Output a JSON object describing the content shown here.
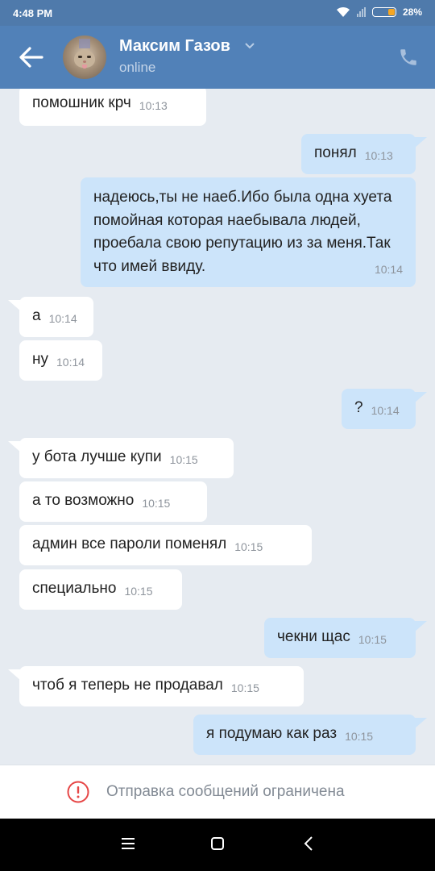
{
  "status_bar": {
    "time": "4:48 PM",
    "battery": "28%",
    "icons": [
      "wifi-icon",
      "signal-icon",
      "battery-icon"
    ]
  },
  "header": {
    "contact_name": "Максим Газов",
    "contact_status": "online",
    "icons": [
      "back-arrow-icon",
      "chevron-down-icon",
      "phone-icon"
    ]
  },
  "messages": [
    {
      "dir": "in",
      "text": "помошник крч",
      "time": "10:13"
    },
    {
      "dir": "out",
      "text": "понял",
      "time": "10:13"
    },
    {
      "dir": "out",
      "text": "надеюсь,ты не наеб.Ибо была одна хуета помойная которая наебывала людей, проебала свою репутацию из за меня.Так что имей ввиду.",
      "time": "10:14"
    },
    {
      "dir": "in",
      "text": "а",
      "time": "10:14"
    },
    {
      "dir": "in",
      "text": "ну",
      "time": "10:14"
    },
    {
      "dir": "out",
      "text": "?",
      "time": "10:14"
    },
    {
      "dir": "in",
      "text": "у бота лучше купи",
      "time": "10:15"
    },
    {
      "dir": "in",
      "text": "а то возможно",
      "time": "10:15"
    },
    {
      "dir": "in",
      "text": "админ все пароли поменял",
      "time": "10:15"
    },
    {
      "dir": "in",
      "text": "специально",
      "time": "10:15"
    },
    {
      "dir": "out",
      "text": "чекни щас",
      "time": "10:15"
    },
    {
      "dir": "in",
      "text": "чтоб я теперь не продавал",
      "time": "10:15"
    },
    {
      "dir": "out",
      "text": "я подумаю как раз",
      "time": "10:15"
    }
  ],
  "restriction": {
    "text": "Отправка сообщений ограничена",
    "icon": "warning-circle-icon",
    "color": "#e64646"
  },
  "colors": {
    "header": "#5181b8",
    "status_bar": "#4f7aab",
    "background": "#e6ebf1",
    "incoming_bubble": "#ffffff",
    "outgoing_bubble": "#cce4fa"
  }
}
